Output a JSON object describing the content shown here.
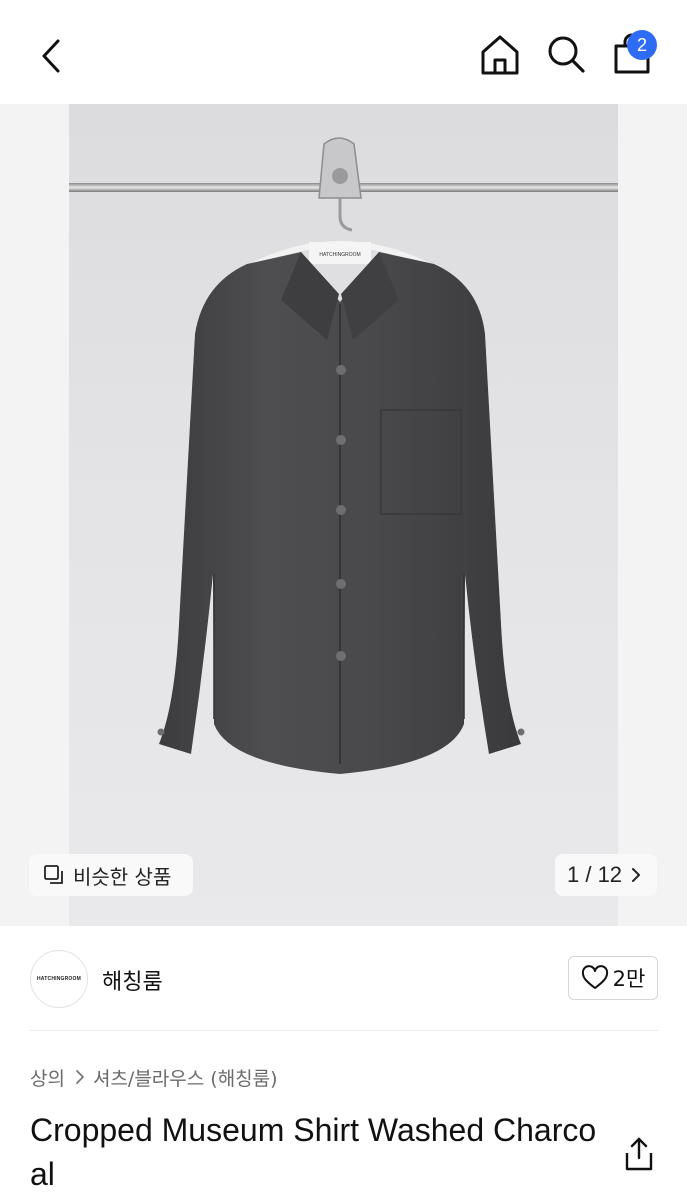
{
  "header": {
    "back_icon": "chevron-left-icon",
    "home_icon": "home-icon",
    "search_icon": "search-icon",
    "cart_icon": "shopping-bag-icon",
    "cart_count": "2",
    "badge_color": "#2f6cf6"
  },
  "gallery": {
    "similar_label": "비슷한 상품",
    "similar_icon": "similar-items-icon",
    "counter": "1 / 12",
    "next_icon": "chevron-right-icon",
    "hanger_tag_text": "HATCHINGROOM"
  },
  "shop": {
    "logo_text": "HATCHINGROOM",
    "name": "해칭룸",
    "likes": "2만",
    "like_icon": "heart-icon"
  },
  "breadcrumb": {
    "category": "상의",
    "subcategory": "셔츠/블라우스 (해칭룸)",
    "separator_icon": "chevron-right-icon"
  },
  "product": {
    "title": "Cropped Museum Shirt Washed Charcoal",
    "share_icon": "share-icon"
  }
}
